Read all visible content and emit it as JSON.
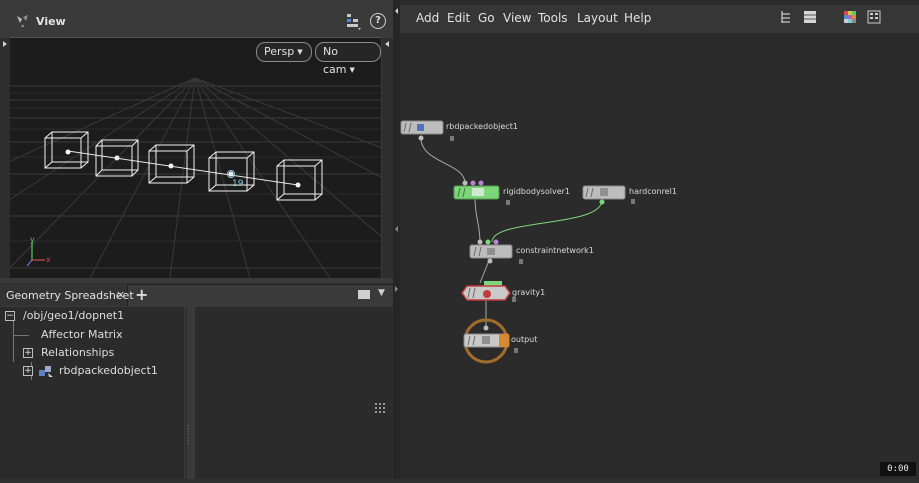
{
  "viewer": {
    "title": "View",
    "camera_menu": "Persp",
    "cam_menu": "No cam",
    "help_glyph": "?",
    "axis_labels": [
      "y",
      "x"
    ],
    "frame_label": "19"
  },
  "spreadsheet": {
    "tab_label": "Geometry Spreadsheet",
    "close_glyph": "×",
    "add_glyph": "+",
    "tree": [
      {
        "label": "/obj/geo1/dopnet1",
        "expander": "−"
      },
      {
        "label": "Affector Matrix",
        "expander": ""
      },
      {
        "label": "Relationships",
        "expander": "+"
      },
      {
        "label": "rbdpackedobject1",
        "expander": "+"
      }
    ]
  },
  "network": {
    "menu": [
      "Add",
      "Edit",
      "Go",
      "View",
      "Tools",
      "Layout",
      "Help"
    ],
    "nodes": {
      "rbdpacked": "rbdpackedobject1",
      "solver": "rigidbodysolver1",
      "hardconrel": "hardconrel1",
      "constraint": "constraintnetwork1",
      "gravity": "gravity1",
      "output": "output"
    },
    "time": "0:00"
  },
  "colors": {
    "solver_green": "#7ed67a",
    "gravity_red": "#c23a3a",
    "output_ring": "#a06d2c",
    "output_flag": "#d6892e",
    "wire": "#a8a8a8",
    "wire_green": "#7ed67a"
  }
}
